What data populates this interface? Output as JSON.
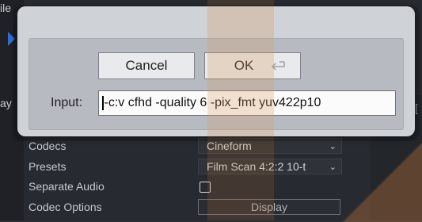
{
  "background": {
    "left_labels": [
      "ile",
      "ay"
    ],
    "right_bracket": "["
  },
  "dialog": {
    "cancel_label": "Cancel",
    "ok_label": "OK",
    "ok_icon": "return-key-icon",
    "input_label": "Input:",
    "input_value": "-c:v cfhd -quality 6 -pix_fmt yuv422p10"
  },
  "properties": [
    {
      "label": "Codecs",
      "control": "select",
      "value": "Cineform"
    },
    {
      "label": "Presets",
      "control": "select",
      "value": "Film Scan 4:2:2 10-t"
    },
    {
      "label": "Separate Audio",
      "control": "checkbox",
      "value": ""
    },
    {
      "label": "Codec Options",
      "control": "button",
      "value": "Display"
    }
  ],
  "colors": {
    "accent_blue": "#2d6fd8",
    "highlight_orange": "#c97a3a"
  }
}
